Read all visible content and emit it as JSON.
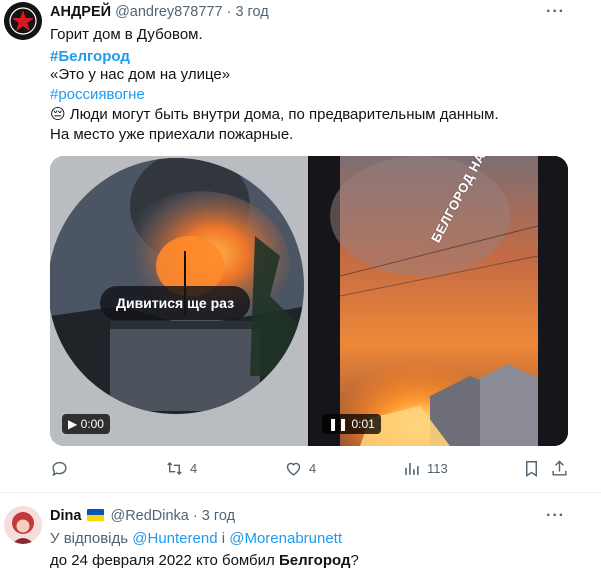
{
  "tweet": {
    "author_name": "АНДРЕЙ",
    "handle": "@andrey878777",
    "separator": "·",
    "time": "3 год",
    "more": "···",
    "lines": {
      "l1": "Горит дом в Дубовом.",
      "hashtag1": "#Белгород",
      "quote": " «Это у нас дом на улице»",
      "hashtag2": "#россиявогне",
      "emoji": "😔",
      "l5": " Люди могут быть внутри дома, по предварительным данным.",
      "l6": "На место уже приехали пожарные."
    },
    "media": {
      "left": {
        "replay_label": "Дивитися ще раз",
        "time": "0:00",
        "play_icon": "▶"
      },
      "right": {
        "watermark": "БЕЛГОРОД НА МАКСИМАЛКАХ",
        "time": "0:01",
        "pause_icon": "❚❚"
      }
    },
    "actions": {
      "reply_count": "",
      "retweet_count": "4",
      "like_count": "4",
      "views_count": "113"
    }
  },
  "reply": {
    "author_name": "Dina",
    "handle": "@RedDinka",
    "separator": "·",
    "time": "3 год",
    "more": "···",
    "reply_prefix": "У відповідь",
    "mention1": "@Hunterend",
    "conj": "і",
    "mention2": "@Morenabrunett",
    "text_before": "до 24 февраля 2022 кто бомбил ",
    "text_bold": "Белгород",
    "text_after": "?"
  },
  "colors": {
    "accent": "#1d9bf0",
    "muted": "#536471",
    "text": "#0f1419"
  }
}
